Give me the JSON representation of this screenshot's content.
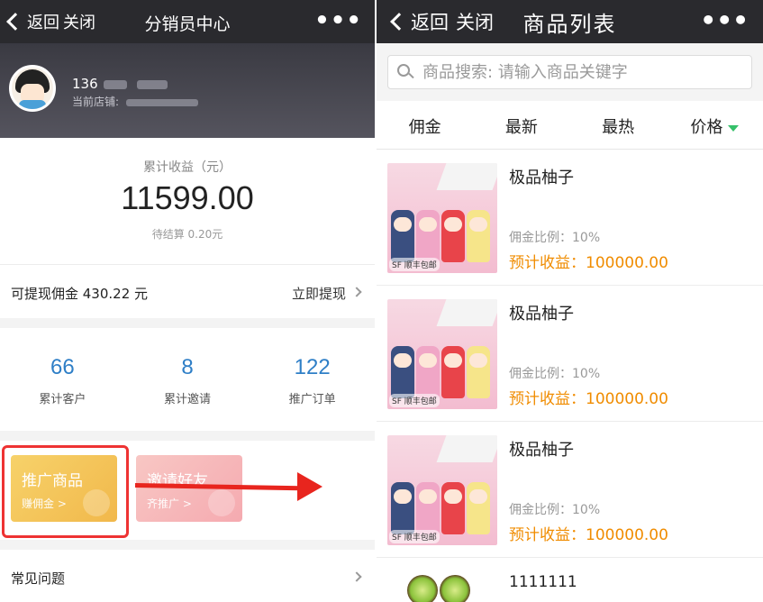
{
  "left": {
    "topbar": {
      "back_label": "返回",
      "close_label": "关闭",
      "title": "分销员中心",
      "more_label": "•••"
    },
    "profile": {
      "phone_prefix": "136",
      "store_label": "当前店铺:"
    },
    "earnings": {
      "label": "累计收益（元）",
      "value": "11599.00",
      "pending": "待结算 0.20元"
    },
    "withdraw": {
      "label": "可提现佣金 430.22 元",
      "action": "立即提现"
    },
    "stats": [
      {
        "value": "66",
        "label": "累计客户"
      },
      {
        "value": "8",
        "label": "累计邀请"
      },
      {
        "value": "122",
        "label": "推广订单"
      }
    ],
    "cards": [
      {
        "title": "推广商品",
        "sub": "赚佣金 >"
      },
      {
        "title": "邀请好友",
        "sub": "齐推广 >"
      }
    ],
    "faq": {
      "label": "常见问题"
    },
    "colors": {
      "accent_blue": "#2f7fc7",
      "highlight_red": "#e33333"
    }
  },
  "right": {
    "topbar": {
      "back_label": "返回",
      "close_label": "关闭",
      "title": "商品列表",
      "more_label": "•••"
    },
    "search": {
      "placeholder": "商品搜索: 请输入商品关键字"
    },
    "tabs": [
      "佣金",
      "最新",
      "最热",
      "价格"
    ],
    "products": [
      {
        "name": "极品柚子",
        "ratio": "佣金比例：10%",
        "profit": "预计收益：100000.00",
        "badge": "SF 顺丰包邮"
      },
      {
        "name": "极品柚子",
        "ratio": "佣金比例：10%",
        "profit": "预计收益：100000.00",
        "badge": "SF 顺丰包邮"
      },
      {
        "name": "极品柚子",
        "ratio": "佣金比例：10%",
        "profit": "预计收益：100000.00",
        "badge": "SF 顺丰包邮"
      },
      {
        "name": "1111111"
      }
    ],
    "colors": {
      "profit_orange": "#f08c00",
      "sort_green": "#36c06a"
    }
  }
}
